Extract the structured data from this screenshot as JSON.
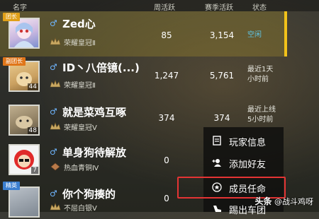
{
  "header": {
    "name": "名字",
    "week_activity": "周活跃",
    "season_activity": "赛季活跃",
    "status": "状态"
  },
  "members": [
    {
      "role_badge": "团长",
      "name": "Zed心",
      "gender": "♂",
      "level": "",
      "rank_icon": "crown-rank-icon",
      "rank": "荣耀皇冠Ⅱ",
      "week": "85",
      "season": "3,154",
      "status": "空闲",
      "selected": true
    },
    {
      "role_badge": "副团长",
      "name": "ID丶八倍镜(...)",
      "gender": "♂",
      "level": "44",
      "rank_icon": "crown-rank-icon",
      "rank": "荣耀皇冠Ⅱ",
      "week": "1,247",
      "season": "5,761",
      "status": "最近1天小时前",
      "selected": false
    },
    {
      "role_badge": "",
      "name": "就是菜鸡互啄",
      "gender": "♂",
      "level": "48",
      "rank_icon": "crown-rank-icon",
      "rank": "荣耀皇冠Ⅴ",
      "week": "374",
      "season": "374",
      "status": "最近上线5小时前",
      "selected": false
    },
    {
      "role_badge": "",
      "name": "单身狗待解放",
      "gender": "♂",
      "level": "7",
      "rank_icon": "diamond-rank-icon",
      "rank": "热血青铜Ⅳ",
      "week": "0",
      "season": "",
      "status": "",
      "selected": false
    },
    {
      "role_badge": "精英",
      "name": "你个狗揍的",
      "gender": "♂",
      "level": "",
      "rank_icon": "crown-rank-icon",
      "rank": "不屈白银Ⅴ",
      "week": "0",
      "season": "",
      "status": "",
      "selected": false
    }
  ],
  "context_menu": {
    "items": [
      {
        "icon": "player-info-icon",
        "label": "玩家信息"
      },
      {
        "icon": "add-friend-icon",
        "label": "添加好友"
      },
      {
        "icon": "appoint-member-icon",
        "label": "成员任命"
      },
      {
        "icon": "kick-icon",
        "label": "踢出车团"
      }
    ]
  },
  "watermark": {
    "prefix": "头条",
    "author": "@战斗鸡呀"
  },
  "colors": {
    "selected_accent": "#f2c21a",
    "highlight_box": "#e43434",
    "gender_male": "#6fb6ff",
    "status_idle": "#5fc6e6"
  }
}
